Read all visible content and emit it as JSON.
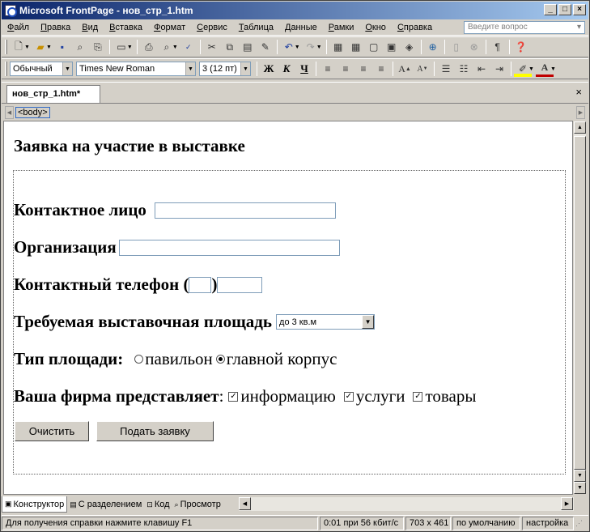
{
  "window": {
    "title": "Microsoft FrontPage - нов_стр_1.htm",
    "controls": {
      "minimize": "_",
      "maximize": "□",
      "close": "×"
    }
  },
  "menu": {
    "items": [
      {
        "u": "Ф",
        "rest": "айл"
      },
      {
        "u": "П",
        "rest": "равка"
      },
      {
        "u": "В",
        "rest": "ид"
      },
      {
        "u": "В",
        "rest": "ставка"
      },
      {
        "u": "Ф",
        "rest": "ормат"
      },
      {
        "u": "С",
        "rest": "ервис"
      },
      {
        "u": "Т",
        "rest": "аблица"
      },
      {
        "u": "Д",
        "rest": "анные"
      },
      {
        "u": "Р",
        "rest": "амки"
      },
      {
        "u": "О",
        "rest": "кно"
      },
      {
        "u": "С",
        "rest": "правка"
      }
    ],
    "ask_placeholder": "Введите вопрос"
  },
  "formatting": {
    "style": "Обычный",
    "font": "Times New Roman",
    "size": "3 (12 пт)",
    "bold": "Ж",
    "italic": "К",
    "underline": "Ч"
  },
  "tabs": {
    "document": "нов_стр_1.htm*",
    "close": "×"
  },
  "tagbar": {
    "tag": "<body>"
  },
  "page": {
    "title": "Заявка на участие в выставке",
    "contact_label": "Контактное лицо",
    "org_label": "Организация",
    "phone_label": "Контактный телефон (",
    "phone_mid": ")",
    "area_label": "Требуемая выставочная площадь",
    "area_select": "до 3 кв.м",
    "type_label": "Тип площади:",
    "type_options": [
      {
        "label": "павильон",
        "checked": false
      },
      {
        "label": "главной корпус",
        "checked": true
      }
    ],
    "represents_label": "Ваша фирма представляет",
    "represents_colon": ":",
    "represents_options": [
      {
        "label": "информацию",
        "checked": true
      },
      {
        "label": "услуги",
        "checked": true
      },
      {
        "label": "товары",
        "checked": true
      }
    ],
    "reset_button": "Очистить",
    "submit_button": "Подать заявку"
  },
  "views": {
    "design": "Конструктор",
    "split": "С разделением",
    "code": "Код",
    "preview": "Просмотр"
  },
  "status": {
    "help": "Для получения справки нажмите клавишу F1",
    "download": "0:01 при 56 кбит/с",
    "size": "703 x 461",
    "schema": "по умолчанию",
    "settings": "настройка"
  }
}
